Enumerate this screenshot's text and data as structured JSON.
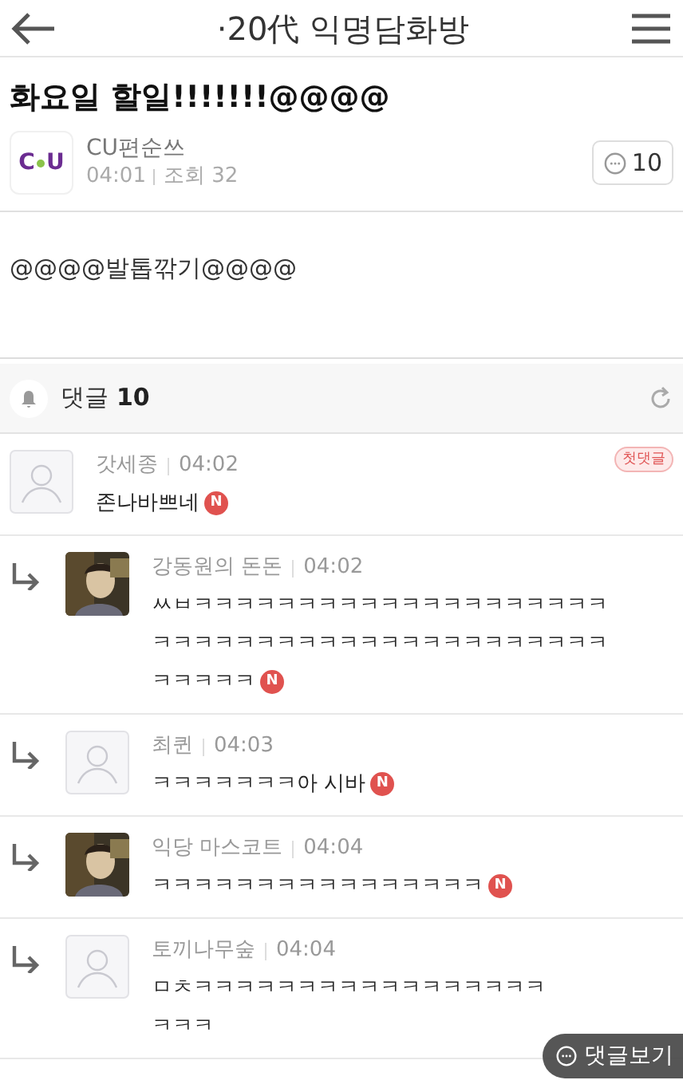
{
  "header": {
    "title": "·20代 익명담화방"
  },
  "post": {
    "title": "화요일 할일!!!!!!!@@@@",
    "logo": [
      "C",
      "U"
    ],
    "author": "CU편순쓰",
    "time": "04:01",
    "views": "조회 32",
    "comment_count": "10",
    "body": "@@@@발톱깎기@@@@"
  },
  "comments_header": {
    "label": "댓글",
    "count": "10"
  },
  "comments": [
    {
      "kind": "comment",
      "avatar": {
        "kind": "default"
      },
      "author": "갓세종",
      "time": "04:02",
      "lines": [
        "존나바쁘네"
      ],
      "badge": "첫댓글",
      "new_mark": "N"
    },
    {
      "kind": "reply",
      "avatar": {
        "kind": "picture"
      },
      "author": "강동원의 돈돈",
      "time": "04:02",
      "lines": [
        "ㅆㅂㅋㅋㅋㅋㅋㅋㅋㅋㅋㅋㅋㅋㅋㅋㅋㅋㅋㅋㅋㅋ",
        "ㅋㅋㅋㅋㅋㅋㅋㅋㅋㅋㅋㅋㅋㅋㅋㅋㅋㅋㅋㅋㅋㅋ",
        "ㅋㅋㅋㅋㅋ"
      ],
      "new_mark": "N"
    },
    {
      "kind": "reply",
      "avatar": {
        "kind": "default"
      },
      "author": "최퀸",
      "time": "04:03",
      "lines": [
        "ㅋㅋㅋㅋㅋㅋㅋ아 시바"
      ],
      "new_mark": "N"
    },
    {
      "kind": "reply",
      "avatar": {
        "kind": "picture"
      },
      "author": "익당 마스코트",
      "time": "04:04",
      "lines": [
        "ㅋㅋㅋㅋㅋㅋㅋㅋㅋㅋㅋㅋㅋㅋㅋㅋ"
      ],
      "new_mark": "N"
    },
    {
      "kind": "reply",
      "avatar": {
        "kind": "default"
      },
      "author": "토끼나무숲",
      "time": "04:04",
      "lines": [
        "ㅁㅊㅋㅋㅋㅋㅋㅋㅋㅋㅋㅋㅋㅋㅋㅋㅋㅋㅋ",
        "ㅋㅋㅋ"
      ]
    }
  ],
  "floating_button": {
    "label": "댓글보기"
  }
}
